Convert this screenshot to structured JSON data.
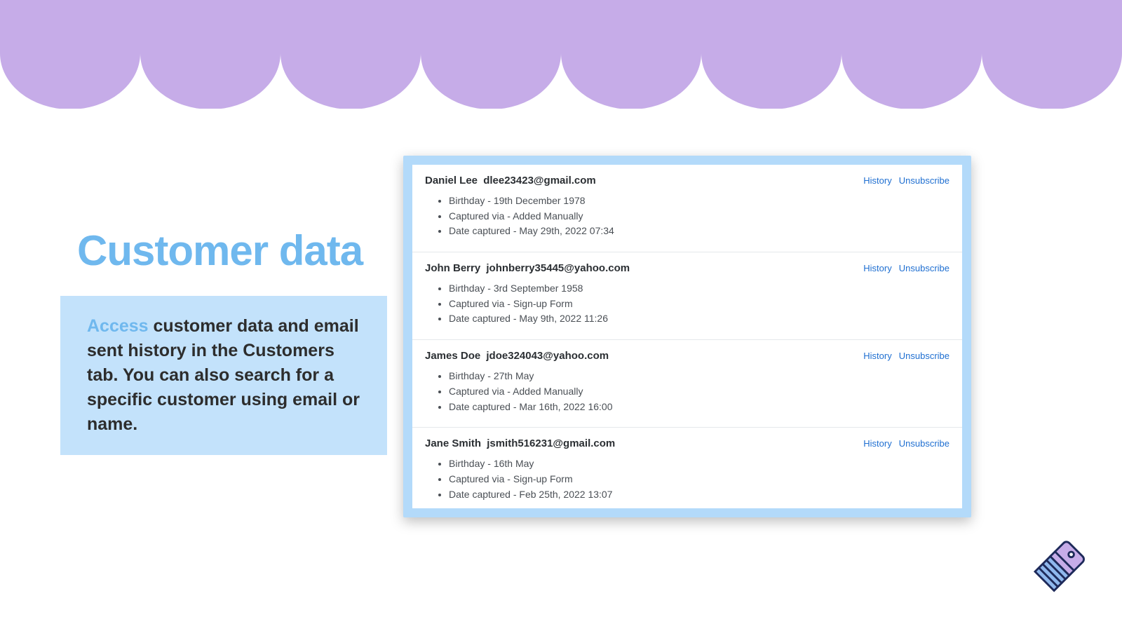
{
  "heading": "Customer data",
  "blurb": {
    "accent": "Access",
    "rest": " customer data and email sent history in the Customers tab. You can also search for a specific customer using email or name."
  },
  "labels": {
    "birthday": "Birthday - ",
    "captured_via": "Captured via - ",
    "date_captured": "Date captured - ",
    "history": "History",
    "unsubscribe": "Unsubscribe"
  },
  "customers": [
    {
      "name": "Daniel Lee",
      "email": "dlee23423@gmail.com",
      "birthday": "19th December 1978",
      "captured_via": "Added Manually",
      "date_captured": "May 29th, 2022 07:34"
    },
    {
      "name": "John Berry",
      "email": "johnberry35445@yahoo.com",
      "birthday": "3rd September 1958",
      "captured_via": "Sign-up Form",
      "date_captured": "May 9th, 2022 11:26"
    },
    {
      "name": "James Doe",
      "email": "jdoe324043@yahoo.com",
      "birthday": "27th May",
      "captured_via": "Added Manually",
      "date_captured": "Mar 16th, 2022 16:00"
    },
    {
      "name": "Jane Smith",
      "email": "jsmith516231@gmail.com",
      "birthday": "16th May",
      "captured_via": "Sign-up Form",
      "date_captured": "Feb 25th, 2022 13:07"
    }
  ]
}
